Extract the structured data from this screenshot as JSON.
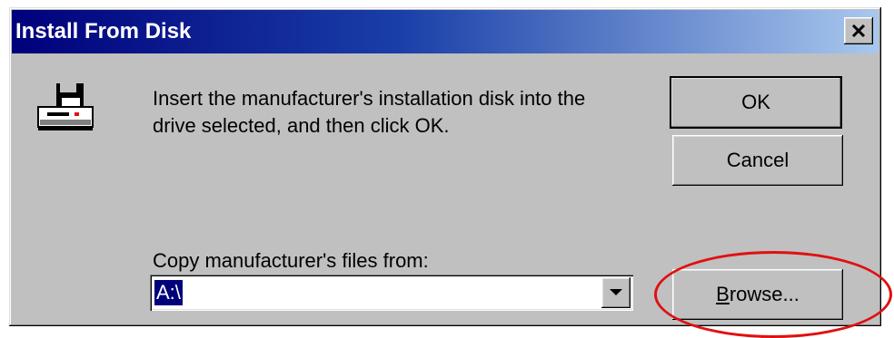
{
  "window": {
    "title": "Install From Disk",
    "close_label": "×"
  },
  "message": {
    "line1": "Insert the manufacturer's installation disk into the",
    "line2": "drive selected, and then click OK."
  },
  "buttons": {
    "ok": "OK",
    "cancel": "Cancel",
    "browse_mnemonic": "B",
    "browse_rest": "rowse..."
  },
  "copy_from": {
    "label": "Copy manufacturer's files from:",
    "value": "A:\\"
  },
  "icons": {
    "disk": "floppy-drive-icon",
    "dropdown": "chevron-down-icon",
    "close": "close-icon"
  },
  "colors": {
    "titlebar_start": "#00007b",
    "titlebar_end": "#a9c8ee",
    "face": "#c0c0c0",
    "highlight_ellipse": "#e01010"
  }
}
